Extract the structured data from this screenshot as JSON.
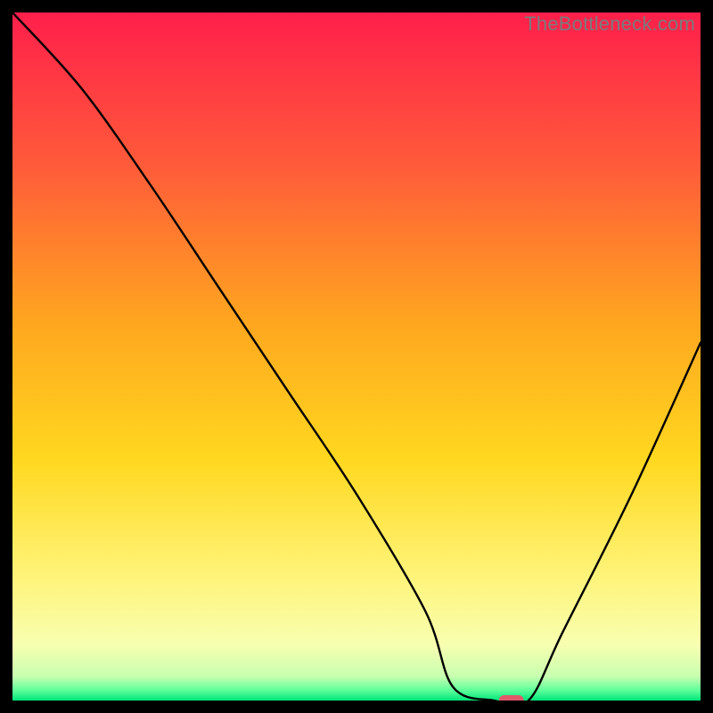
{
  "watermark": "TheBottleneck.com",
  "chart_data": {
    "type": "line",
    "title": "",
    "xlabel": "",
    "ylabel": "",
    "xlim": [
      0,
      100
    ],
    "ylim": [
      0,
      100
    ],
    "x": [
      0,
      10,
      20,
      30,
      40,
      50,
      60,
      64,
      70,
      75,
      80,
      90,
      100
    ],
    "values": [
      100,
      89,
      75,
      60,
      45,
      30,
      13,
      2,
      0,
      0,
      10,
      30,
      52
    ],
    "marker": {
      "x": 72.5,
      "y": 0,
      "color": "#e05a6a"
    },
    "gradient_stops": [
      {
        "pos": 0.0,
        "color": "#ff1f4b"
      },
      {
        "pos": 0.22,
        "color": "#ff5a3a"
      },
      {
        "pos": 0.45,
        "color": "#ffa61f"
      },
      {
        "pos": 0.65,
        "color": "#ffd81f"
      },
      {
        "pos": 0.82,
        "color": "#fff47a"
      },
      {
        "pos": 0.92,
        "color": "#f7ffb0"
      },
      {
        "pos": 0.965,
        "color": "#c8ffb0"
      },
      {
        "pos": 0.985,
        "color": "#5eff9a"
      },
      {
        "pos": 1.0,
        "color": "#00e57a"
      }
    ]
  }
}
